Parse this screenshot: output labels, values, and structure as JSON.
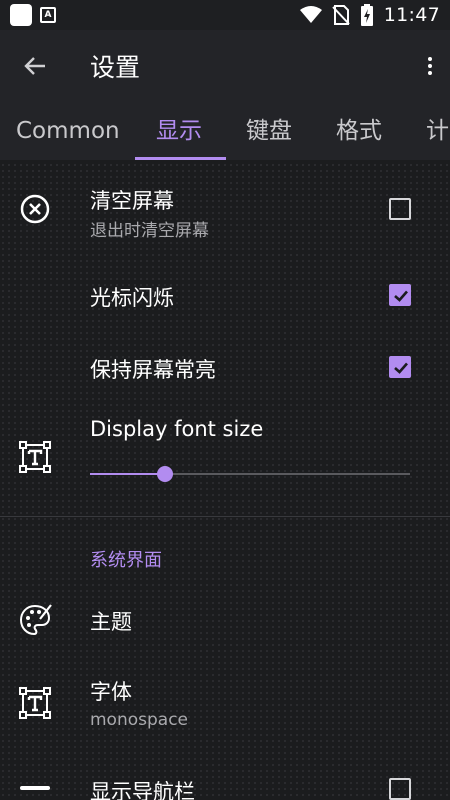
{
  "status_bar": {
    "time": "11:47",
    "icons": [
      "notification-square-icon",
      "app-a-icon",
      "wifi-icon",
      "no-sim-icon",
      "battery-charging-icon"
    ]
  },
  "app_bar": {
    "title": "设置",
    "back_icon": "arrow-back-icon",
    "more_icon": "more-vert-icon"
  },
  "tabs": [
    {
      "label": "Common",
      "active": false
    },
    {
      "label": "显示",
      "active": true
    },
    {
      "label": "键盘",
      "active": false
    },
    {
      "label": "格式",
      "active": false
    },
    {
      "label": "计",
      "active": false
    }
  ],
  "settings": {
    "clear_screen": {
      "title": "清空屏幕",
      "subtitle": "退出时清空屏幕",
      "checked": false,
      "icon": "close-circle-icon"
    },
    "cursor_blink": {
      "title": "光标闪烁",
      "checked": true
    },
    "keep_screen_on": {
      "title": "保持屏幕常亮",
      "checked": true
    },
    "display_font_size": {
      "title": "Display font size",
      "icon": "text-frame-icon",
      "value_fraction": 0.235
    }
  },
  "section": {
    "header": "系统界面",
    "theme": {
      "title": "主题",
      "icon": "palette-icon"
    },
    "font": {
      "title": "字体",
      "subtitle": "monospace",
      "icon": "text-frame-icon"
    },
    "show_nav_bar": {
      "title": "显示导航栏",
      "checked": false,
      "icon": "nav-bar-icon"
    }
  },
  "colors": {
    "accent": "#b28cf0",
    "background": "#1b1c1e",
    "app_bar": "#232428"
  }
}
